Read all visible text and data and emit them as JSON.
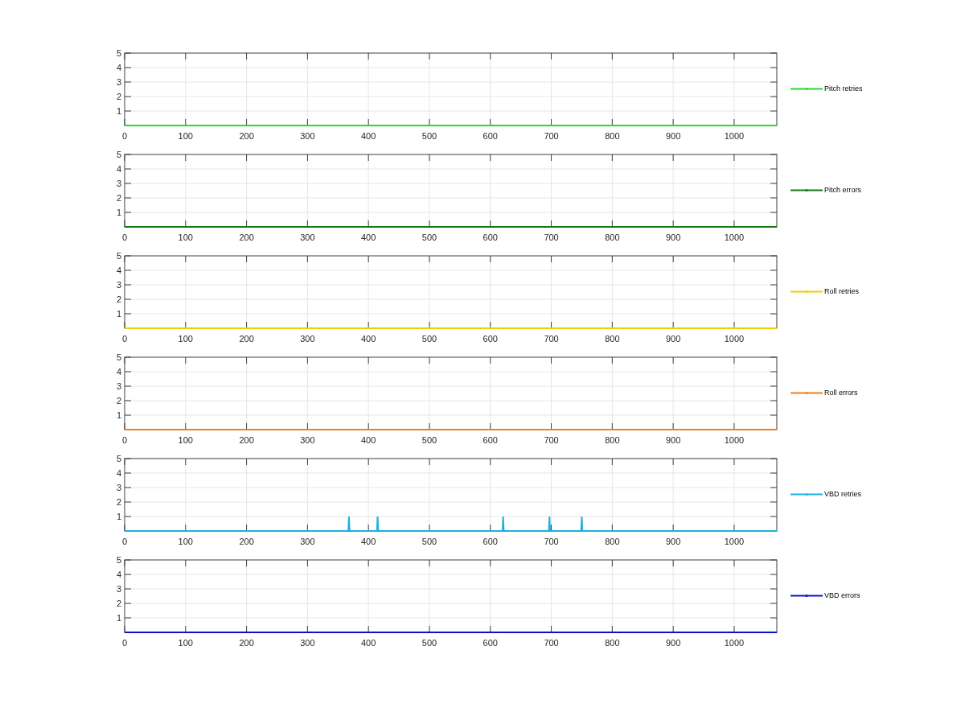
{
  "charts": [
    {
      "chart_data": {
        "type": "line",
        "grid": true,
        "x": [
          0,
          1070
        ],
        "xlim": [
          0,
          1070
        ],
        "ylim": [
          0,
          5
        ],
        "xticks": [
          0,
          100,
          200,
          300,
          400,
          500,
          600,
          700,
          800,
          900,
          1000
        ],
        "yticks": [
          1,
          2,
          3,
          4,
          5
        ],
        "series": [
          {
            "name": "Pitch retries",
            "color": "#22dd22",
            "values": [
              0,
              0
            ]
          }
        ]
      }
    },
    {
      "chart_data": {
        "type": "line",
        "grid": true,
        "x": [
          0,
          1070
        ],
        "xlim": [
          0,
          1070
        ],
        "ylim": [
          0,
          5
        ],
        "xticks": [
          0,
          100,
          200,
          300,
          400,
          500,
          600,
          700,
          800,
          900,
          1000
        ],
        "yticks": [
          1,
          2,
          3,
          4,
          5
        ],
        "series": [
          {
            "name": "Pitch errors",
            "color": "#127a12",
            "values": [
              0,
              0
            ]
          }
        ]
      }
    },
    {
      "chart_data": {
        "type": "line",
        "grid": true,
        "x": [
          0,
          1070
        ],
        "xlim": [
          0,
          1070
        ],
        "ylim": [
          0,
          5
        ],
        "xticks": [
          0,
          100,
          200,
          300,
          400,
          500,
          600,
          700,
          800,
          900,
          1000
        ],
        "yticks": [
          1,
          2,
          3,
          4,
          5
        ],
        "series": [
          {
            "name": "Roll retries",
            "color": "#f2d000",
            "values": [
              0,
              0
            ]
          }
        ]
      }
    },
    {
      "chart_data": {
        "type": "line",
        "grid": true,
        "x": [
          0,
          1070
        ],
        "xlim": [
          0,
          1070
        ],
        "ylim": [
          0,
          5
        ],
        "xticks": [
          0,
          100,
          200,
          300,
          400,
          500,
          600,
          700,
          800,
          900,
          1000
        ],
        "yticks": [
          1,
          2,
          3,
          4,
          5
        ],
        "series": [
          {
            "name": "Roll errors",
            "color": "#ee7f1c",
            "values": [
              0,
              0
            ]
          }
        ]
      }
    },
    {
      "chart_data": {
        "type": "line",
        "grid": true,
        "x": [
          0,
          367,
          368,
          369,
          414,
          415,
          416,
          620,
          621,
          622,
          696,
          697,
          698,
          749,
          750,
          751,
          1070
        ],
        "xlim": [
          0,
          1070
        ],
        "ylim": [
          0,
          5
        ],
        "xticks": [
          0,
          100,
          200,
          300,
          400,
          500,
          600,
          700,
          800,
          900,
          1000
        ],
        "yticks": [
          1,
          2,
          3,
          4,
          5
        ],
        "series": [
          {
            "name": "VBD retries",
            "color": "#1eb0e0",
            "values": [
              0,
              0,
              1,
              0,
              0,
              1,
              0,
              0,
              1,
              0,
              0,
              1,
              0,
              0,
              1,
              0,
              0
            ]
          }
        ]
      }
    },
    {
      "chart_data": {
        "type": "line",
        "grid": true,
        "x": [
          0,
          1070
        ],
        "xlim": [
          0,
          1070
        ],
        "ylim": [
          0,
          5
        ],
        "xticks": [
          0,
          100,
          200,
          300,
          400,
          500,
          600,
          700,
          800,
          900,
          1000
        ],
        "yticks": [
          1,
          2,
          3,
          4,
          5
        ],
        "series": [
          {
            "name": "VBD errors",
            "color": "#0a14c0",
            "values": [
              0,
              0
            ]
          }
        ]
      }
    }
  ]
}
